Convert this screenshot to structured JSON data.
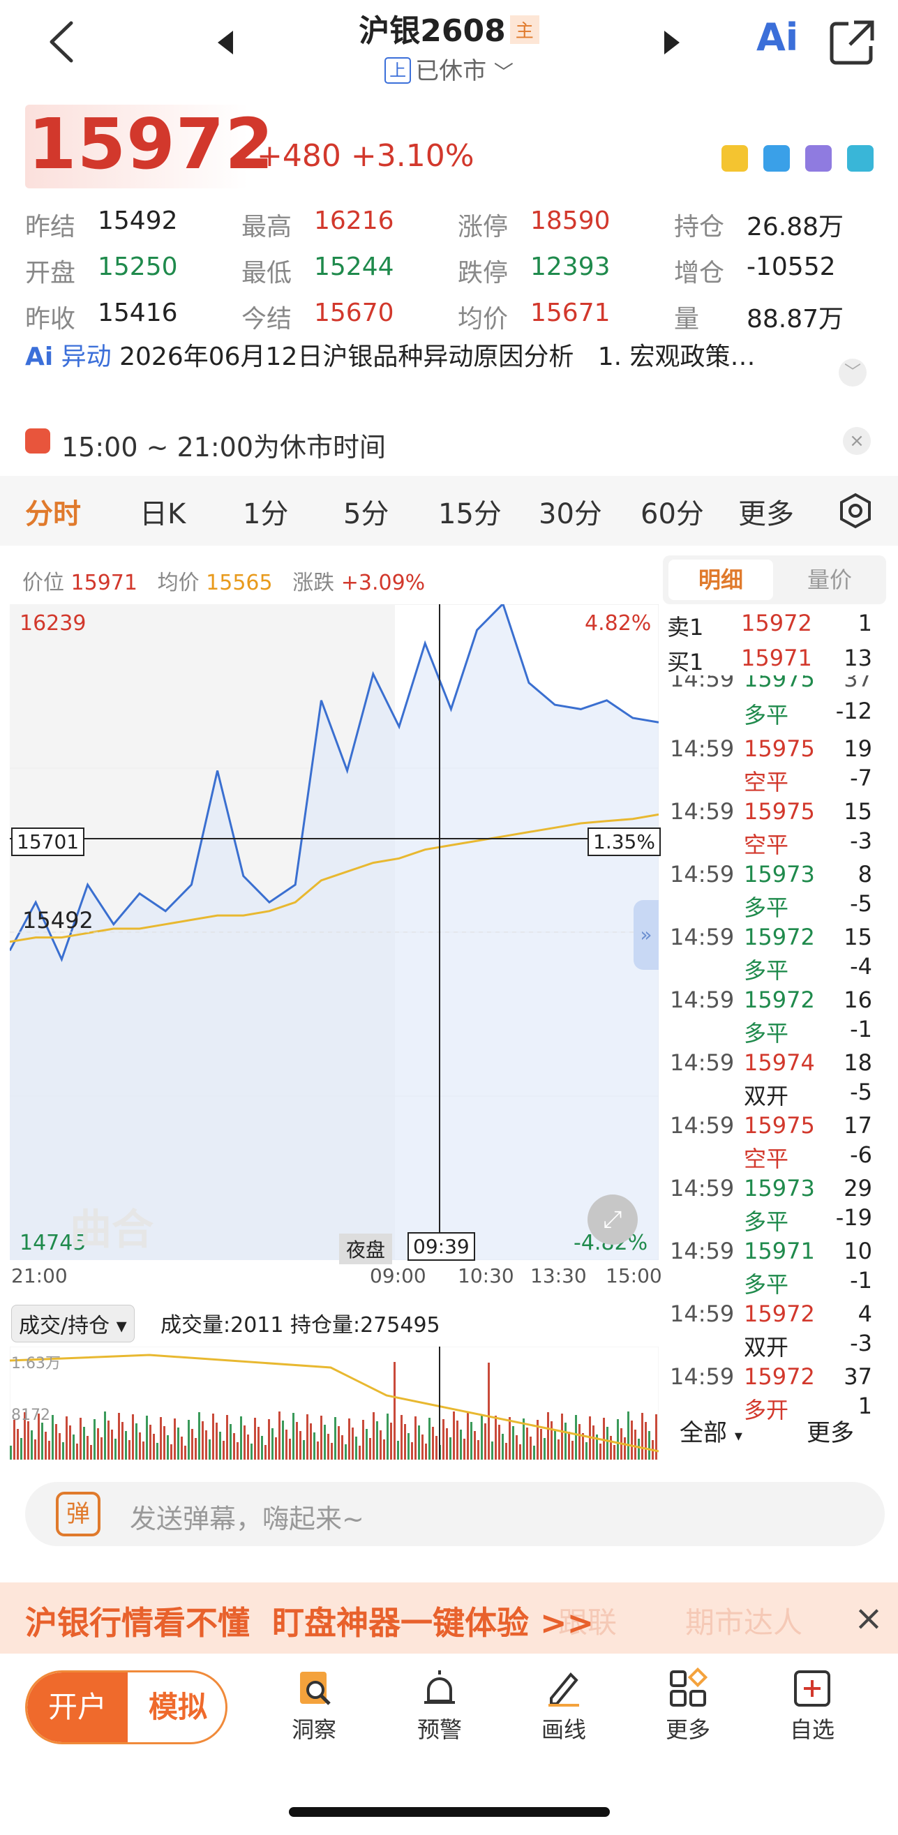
{
  "header": {
    "title": "沪银2608",
    "main_tag": "主",
    "exchange_tag": "上",
    "status": "已休市",
    "ai_label": "Ai"
  },
  "quote": {
    "price": "15972",
    "change": "+480",
    "change_pct": "+3.10%"
  },
  "stats": [
    [
      {
        "label": "昨结",
        "value": "15492",
        "color": "#222"
      },
      {
        "label": "最高",
        "value": "16216",
        "color": "#d2382c"
      },
      {
        "label": "涨停",
        "value": "18590",
        "color": "#d2382c"
      },
      {
        "label": "持仓",
        "value": "26.88万",
        "color": "#222"
      }
    ],
    [
      {
        "label": "开盘",
        "value": "15250",
        "color": "#1f8a4c"
      },
      {
        "label": "最低",
        "value": "15244",
        "color": "#1f8a4c"
      },
      {
        "label": "跌停",
        "value": "12393",
        "color": "#1f8a4c"
      },
      {
        "label": "增仓",
        "value": "-10552",
        "color": "#222"
      }
    ],
    [
      {
        "label": "昨收",
        "value": "15416",
        "color": "#222"
      },
      {
        "label": "今结",
        "value": "15670",
        "color": "#d2382c"
      },
      {
        "label": "均价",
        "value": "15671",
        "color": "#d2382c"
      },
      {
        "label": "量",
        "value": "88.87万",
        "color": "#222"
      }
    ]
  ],
  "news": {
    "ai": "Ai",
    "tag": "异动",
    "text": "2026年06月12日沪银品种异动原因分析",
    "tail": "1. 宏观政策…"
  },
  "notice": {
    "text": "15:00 ~ 21:00为休市时间"
  },
  "tabs": [
    "分时",
    "日K",
    "1分",
    "5分",
    "15分",
    "30分",
    "60分",
    "更多"
  ],
  "chart": {
    "info": {
      "price_label": "价位",
      "price": "15971",
      "avg_label": "均价",
      "avg": "15565",
      "chg_label": "涨跌",
      "chg": "+3.09%"
    },
    "y_max": "16239",
    "y_max_pct": "4.82%",
    "y_min": "14745",
    "y_min_pct": "-4.82%",
    "prev_close": "15492",
    "cross_price": "15701",
    "cross_pct": "1.35%",
    "cross_time": "09:39",
    "night_label": "夜盘",
    "watermark": "曲合",
    "x_ticks": [
      "21:00",
      "09:00",
      "10:30",
      "13:30",
      "15:00"
    ],
    "vol_selector": "成交/持仓",
    "vol_text": "成交量:2011 持仓量:275495",
    "vol_max": "1.63万",
    "vol_mid": "8172"
  },
  "chart_data": {
    "type": "line",
    "title": "",
    "xlabel": "",
    "ylabel": "",
    "ylim": [
      14745,
      16239
    ],
    "series": [
      {
        "name": "价位",
        "values": [
          15450,
          15560,
          15430,
          15600,
          15510,
          15580,
          15540,
          15600,
          15860,
          15620,
          15560,
          15600,
          16020,
          15860,
          16080,
          15960,
          16150,
          16000,
          16180,
          16240,
          16060,
          16010,
          16000,
          16020,
          15980,
          15970
        ]
      },
      {
        "name": "均价",
        "values": [
          15470,
          15480,
          15480,
          15490,
          15500,
          15500,
          15510,
          15520,
          15530,
          15530,
          15540,
          15560,
          15610,
          15630,
          15650,
          15660,
          15680,
          15690,
          15700,
          15710,
          15720,
          15730,
          15740,
          15745,
          15750,
          15760
        ]
      }
    ]
  },
  "detail": {
    "tab_active": "明细",
    "tab_other": "量价",
    "sell1": {
      "label": "卖1",
      "price": "15972",
      "qty": "1"
    },
    "buy1": {
      "label": "买1",
      "price": "15971",
      "qty": "13"
    },
    "partial": {
      "time": "14:59",
      "price": "15975",
      "qty": "37"
    },
    "rows": [
      {
        "time": "14:59",
        "price": "15975",
        "qty": "19",
        "type": "空平",
        "delta": "-7",
        "pc": "#d2382c",
        "tc": "#d2382c"
      },
      {
        "time": "14:59",
        "price": "15975",
        "qty": "15",
        "type": "空平",
        "delta": "-3",
        "pc": "#d2382c",
        "tc": "#d2382c"
      },
      {
        "time": "14:59",
        "price": "15973",
        "qty": "8",
        "type": "多平",
        "delta": "-5",
        "pc": "#1f8a4c",
        "tc": "#1f8a4c"
      },
      {
        "time": "14:59",
        "price": "15972",
        "qty": "15",
        "type": "多平",
        "delta": "-4",
        "pc": "#1f8a4c",
        "tc": "#1f8a4c"
      },
      {
        "time": "14:59",
        "price": "15972",
        "qty": "16",
        "type": "多平",
        "delta": "-1",
        "pc": "#1f8a4c",
        "tc": "#1f8a4c"
      },
      {
        "time": "14:59",
        "price": "15974",
        "qty": "18",
        "type": "双开",
        "delta": "-5",
        "pc": "#d2382c",
        "tc": "#222"
      },
      {
        "time": "14:59",
        "price": "15975",
        "qty": "17",
        "type": "空平",
        "delta": "-6",
        "pc": "#d2382c",
        "tc": "#d2382c"
      },
      {
        "time": "14:59",
        "price": "15973",
        "qty": "29",
        "type": "多平",
        "delta": "-19",
        "pc": "#1f8a4c",
        "tc": "#1f8a4c"
      },
      {
        "time": "14:59",
        "price": "15971",
        "qty": "10",
        "type": "多平",
        "delta": "-1",
        "pc": "#1f8a4c",
        "tc": "#1f8a4c"
      },
      {
        "time": "14:59",
        "price": "15972",
        "qty": "4",
        "type": "双开",
        "delta": "-3",
        "pc": "#d2382c",
        "tc": "#222"
      },
      {
        "time": "14:59",
        "price": "15972",
        "qty": "37",
        "type": "多开",
        "delta": "1",
        "pc": "#d2382c",
        "tc": "#d2382c"
      }
    ],
    "first_partial_type": "多平",
    "first_partial_delta": "-12",
    "all": "全部",
    "more": "更多"
  },
  "danmaku": {
    "icon": "弹",
    "placeholder": "发送弹幕，嗨起来~"
  },
  "banner": {
    "text": "沪银行情看不懂  盯盘神器一键体验 >>",
    "faint1": "跟联",
    "faint2": "期市达人"
  },
  "bottom": {
    "open": "开户",
    "sim": "模拟",
    "items": [
      "洞察",
      "预警",
      "画线",
      "更多",
      "自选"
    ]
  }
}
